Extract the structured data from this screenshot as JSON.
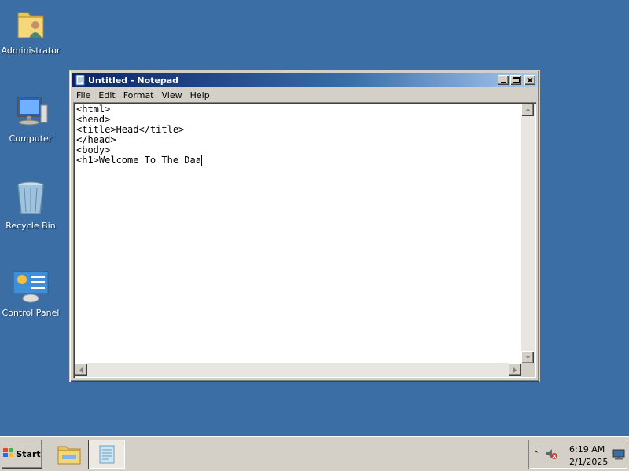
{
  "desktop": {
    "icons": [
      {
        "label": "Administrator",
        "icon": "user-folder-icon"
      },
      {
        "label": "Computer",
        "icon": "computer-icon"
      },
      {
        "label": "Recycle Bin",
        "icon": "recycle-bin-icon"
      },
      {
        "label": "Control Panel",
        "icon": "control-panel-icon"
      }
    ]
  },
  "window": {
    "title": "Untitled - Notepad",
    "menu": [
      "File",
      "Edit",
      "Format",
      "View",
      "Help"
    ],
    "content": "<html>\n<head>\n<title>Head</title>\n</head>\n<body>\n<h1>Welcome To The Daa"
  },
  "taskbar": {
    "start_label": "Start",
    "time": "6:19 AM",
    "date": "2/1/2025"
  },
  "colors": {
    "desktop": "#3a6ea5",
    "titlebar_active": "#0a246a",
    "chrome": "#d4d0c8"
  }
}
